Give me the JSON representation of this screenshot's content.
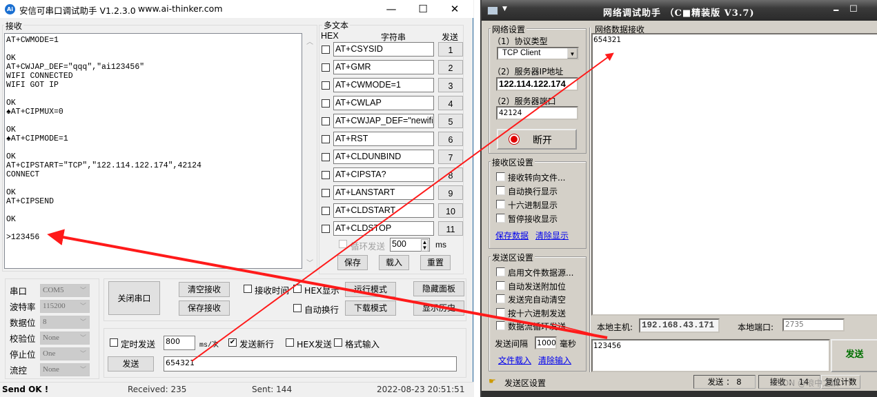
{
  "left_window": {
    "title": "安信可串口调试助手 V1.2.3.0",
    "url": "www.ai-thinker.com",
    "icon_text": "Ai",
    "minimize": "—",
    "maximize": "☐",
    "close": "✕",
    "receive_label": "接收",
    "receive_text": "AT+CWMODE=1\n\nOK\nAT+CWJAP_DEF=\"qqq\",\"ai123456\"\nWIFI CONNECTED\nWIFI GOT IP\n\nOK\n♠AT+CIPMUX=0\n\nOK\n♠AT+CIPMODE=1\n\nOK\nAT+CIPSTART=\"TCP\",\"122.114.122.174\",42124\nCONNECT\n\nOK\nAT+CIPSEND\n\nOK\n\n>123456",
    "multitext": {
      "label": "多文本",
      "hex_header": "HEX",
      "string_header": "字符串",
      "send_header": "发送",
      "rows": [
        {
          "text": "AT+CSYSID",
          "btn": "1"
        },
        {
          "text": "AT+GMR",
          "btn": "2"
        },
        {
          "text": "AT+CWMODE=1",
          "btn": "3"
        },
        {
          "text": "AT+CWLAP",
          "btn": "4"
        },
        {
          "text": "AT+CWJAP_DEF=\"newifi_",
          "btn": "5"
        },
        {
          "text": "AT+RST",
          "btn": "6"
        },
        {
          "text": "AT+CLDUNBIND",
          "btn": "7"
        },
        {
          "text": "AT+CIPSTA?",
          "btn": "8"
        },
        {
          "text": "AT+LANSTART",
          "btn": "9"
        },
        {
          "text": "AT+CLDSTART",
          "btn": "10"
        },
        {
          "text": "AT+CLDSTOP",
          "btn": "11"
        }
      ],
      "loop_send": "循环发送",
      "loop_ms_value": "500",
      "ms": "ms",
      "save": "保存",
      "load": "载入",
      "reset": "重置"
    },
    "port_settings": [
      {
        "label": "串口",
        "value": "COM5"
      },
      {
        "label": "波特率",
        "value": "115200"
      },
      {
        "label": "数据位",
        "value": "8"
      },
      {
        "label": "校验位",
        "value": "None"
      },
      {
        "label": "停止位",
        "value": "One"
      },
      {
        "label": "流控",
        "value": "None"
      }
    ],
    "close_port": "关闭串口",
    "clear_recv": "清空接收",
    "save_recv": "保存接收",
    "recv_time": "接收时间",
    "hex_display": "HEX显示",
    "run_mode": "运行模式",
    "hide_panel": "隐藏面板",
    "auto_newline": "自动换行",
    "download_mode": "下载模式",
    "show_history": "显示历史",
    "timed_send": "定时发送",
    "timed_value": "800",
    "ms_per": "ms/次",
    "send_newline": "发送新行",
    "hex_send": "HEX发送",
    "format_input": "格式输入",
    "send": "发送",
    "send_input": "654321",
    "status": {
      "msg": "Send OK !",
      "received": "Received: 235",
      "sent": "Sent: 144",
      "time": "2022-08-23 20:51:51"
    }
  },
  "right_window": {
    "title": "网络调试助手 （C■精装版 V3.7)",
    "net_settings": "网络设置",
    "protocol_label": "（1）协议类型",
    "protocol_value": "TCP Client",
    "server_ip_label": "（2）服务器IP地址",
    "server_ip": "122.114.122.174",
    "server_port_label": "（2）服务器端口",
    "server_port": "42124",
    "disconnect": "断开",
    "recv_area": "网络数据接收",
    "recv_text": "654321",
    "recv_settings": "接收区设置",
    "recv_opts": [
      "接收转向文件...",
      "自动换行显示",
      "十六进制显示",
      "暂停接收显示"
    ],
    "save_data": "保存数据",
    "clear_display": "清除显示",
    "send_settings": "发送区设置",
    "send_opts": [
      "启用文件数据源...",
      "自动发送附加位",
      "发送完自动清空",
      "按十六进制发送",
      "数据流循环发送"
    ],
    "send_interval": "发送间隔",
    "interval_value": "1000",
    "ms_unit": "毫秒",
    "file_load": "文件载入",
    "clear_input": "清除输入",
    "local_host_label": "本地主机:",
    "local_host": "192.168.43.171",
    "local_port_label": "本地端口:",
    "local_port": "2735",
    "send_text": "123456",
    "send_btn": "发送",
    "status_text": "发送区设置",
    "sent_count": "发送 ： 8",
    "recv_count": "接收 ： 14",
    "reset_count": "复位计数",
    "watermark": "CSDN @琅中之鳞"
  }
}
